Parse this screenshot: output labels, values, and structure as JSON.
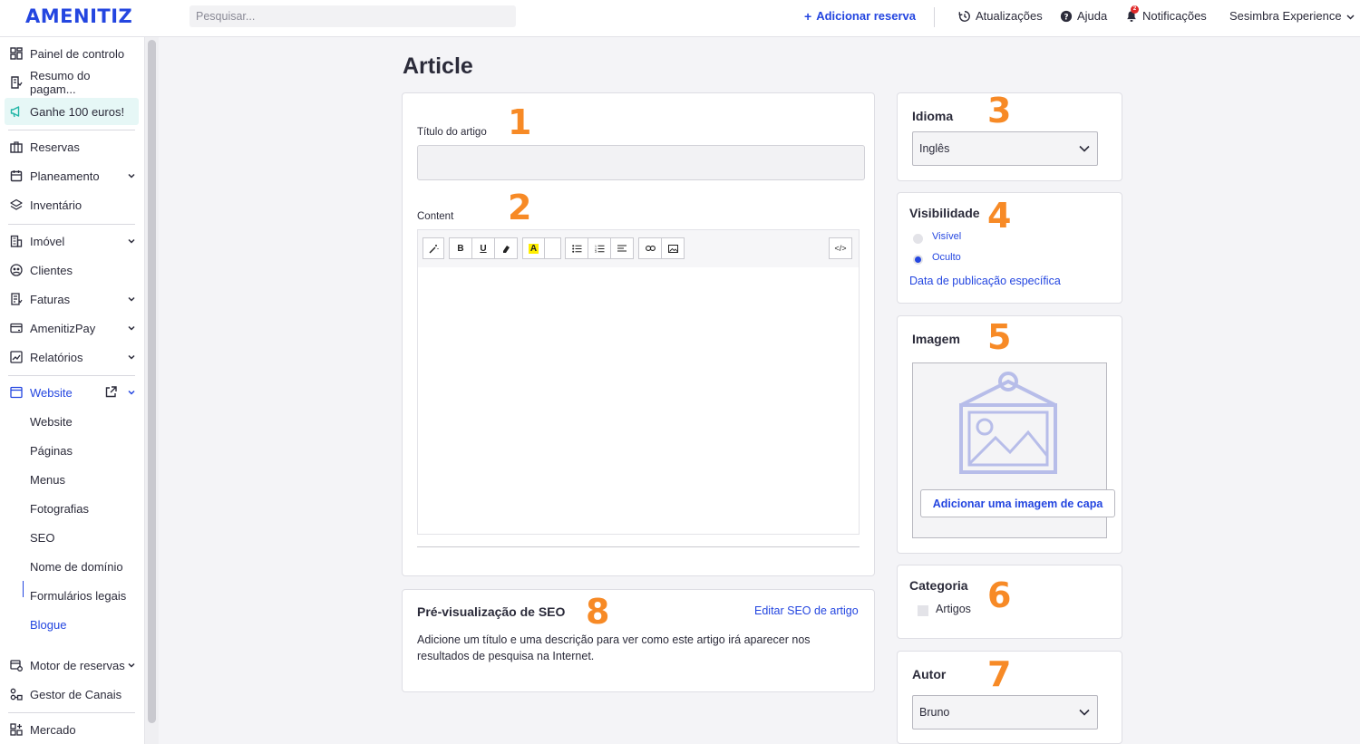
{
  "brand": {
    "logo": "AMENITIZ",
    "accent": "#2446e0",
    "marker_color": "#f78a26"
  },
  "topbar": {
    "search_placeholder": "Pesquisar...",
    "add_booking": "Adicionar reserva",
    "updates": "Atualizações",
    "help": "Ajuda",
    "notifications": "Notificações",
    "notifications_badge": "2",
    "account": "Sesimbra Experience"
  },
  "sidebar": {
    "items": [
      {
        "label": "Painel de controlo",
        "icon": "dashboard-icon"
      },
      {
        "label": "Resumo do pagam...",
        "icon": "receipt-icon"
      },
      {
        "label": "Ganhe 100 euros!",
        "icon": "megaphone-icon"
      },
      {
        "label": "Reservas",
        "icon": "briefcase-icon"
      },
      {
        "label": "Planeamento",
        "icon": "calendar-icon"
      },
      {
        "label": "Inventário",
        "icon": "layers-icon"
      },
      {
        "label": "Imóvel",
        "icon": "building-icon"
      },
      {
        "label": "Clientes",
        "icon": "users-icon"
      },
      {
        "label": "Faturas",
        "icon": "invoice-icon"
      },
      {
        "label": "AmenitizPay",
        "icon": "card-icon"
      },
      {
        "label": "Relatórios",
        "icon": "chart-icon"
      },
      {
        "label": "Website",
        "icon": "browser-icon"
      },
      {
        "label": "Motor de reservas",
        "icon": "booking-engine-icon"
      },
      {
        "label": "Gestor de Canais",
        "icon": "channels-icon"
      },
      {
        "label": "Mercado",
        "icon": "market-icon"
      }
    ],
    "website_sub": [
      "Website",
      "Páginas",
      "Menus",
      "Fotografias",
      "SEO",
      "Nome de domínio",
      "Formulários legais",
      "Blogue"
    ]
  },
  "page": {
    "title": "Article"
  },
  "article": {
    "title_label": "Título do artigo",
    "title_value": "",
    "content_label": "Content"
  },
  "language": {
    "heading": "Idioma",
    "selected": "Inglês"
  },
  "visibility": {
    "heading": "Visibilidade",
    "options": [
      "Visível",
      "Oculto"
    ],
    "selected": "Oculto",
    "specific_date_link": "Data de publicação específica"
  },
  "image": {
    "heading": "Imagem",
    "add_cover_button": "Adicionar uma imagem de capa"
  },
  "category": {
    "heading": "Categoria",
    "options": [
      "Artigos"
    ]
  },
  "author": {
    "heading": "Autor",
    "selected": "Bruno"
  },
  "seo": {
    "heading": "Pré-visualização de SEO",
    "edit_link": "Editar SEO de artigo",
    "description": "Adicione um título e uma descrição para ver como este artigo irá aparecer nos resultados de pesquisa na Internet."
  },
  "markers": [
    "1",
    "2",
    "3",
    "4",
    "5",
    "6",
    "7",
    "8"
  ]
}
